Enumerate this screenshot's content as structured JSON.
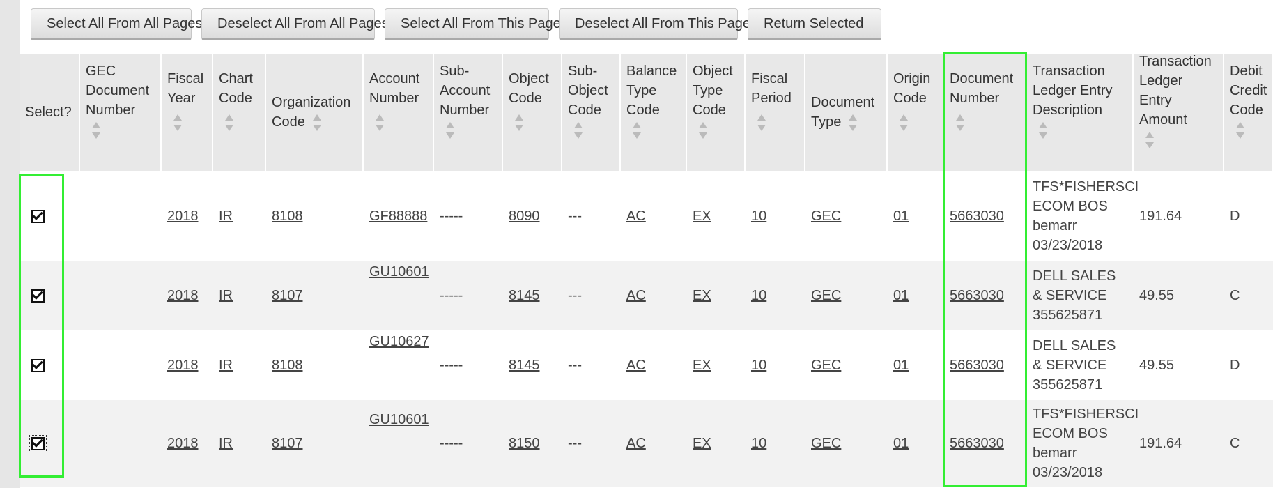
{
  "buttons": {
    "select_all_pages": "Select All From All Pages",
    "deselect_all_pages": "Deselect All From All Pages",
    "select_all_this_page": "Select All From This Page",
    "deselect_all_this_page": "Deselect All From This Page",
    "return_selected": "Return Selected"
  },
  "table": {
    "headers": {
      "select": "Select?",
      "gec_document_number": "GEC Document Number",
      "fiscal_year": "Fiscal Year",
      "chart_code": "Chart Code",
      "organization_code": "Organization Code",
      "account_number": "Account Number",
      "sub_account_number": "Sub-Account Number",
      "object_code": "Object Code",
      "sub_object_code": "Sub-Object Code",
      "balance_type_code": "Balance Type Code",
      "object_type_code": "Object Type Code",
      "fiscal_period": "Fiscal Period",
      "document_type": "Document Type",
      "origin_code": "Origin Code",
      "document_number": "Document Number",
      "description": "Transaction Ledger Entry Description",
      "amount": "Transaction Ledger Entry Amount",
      "debit_credit_code": "Debit Credit Code"
    },
    "rows": [
      {
        "selected": true,
        "gec_document_number": "",
        "fiscal_year": "2018",
        "chart_code": "IR",
        "organization_code": "8108",
        "account_number": "GF88888",
        "sub_account_number": "-----",
        "object_code": "8090",
        "sub_object_code": "---",
        "balance_type_code": "AC",
        "object_type_code": "EX",
        "fiscal_period": "10",
        "document_type": "GEC",
        "origin_code": "01",
        "document_number": "5663030",
        "description": "TFS*FISHERSCI ECOM BOS bemarr 03/23/2018",
        "amount": "191.64",
        "debit_credit_code": "D"
      },
      {
        "selected": true,
        "gec_document_number": "",
        "fiscal_year": "2018",
        "chart_code": "IR",
        "organization_code": "8107",
        "account_number": "GU10601",
        "sub_account_number": "-----",
        "object_code": "8145",
        "sub_object_code": "---",
        "balance_type_code": "AC",
        "object_type_code": "EX",
        "fiscal_period": "10",
        "document_type": "GEC",
        "origin_code": "01",
        "document_number": "5663030",
        "description": "DELL SALES & SERVICE 355625871",
        "amount": "49.55",
        "debit_credit_code": "C"
      },
      {
        "selected": true,
        "gec_document_number": "",
        "fiscal_year": "2018",
        "chart_code": "IR",
        "organization_code": "8108",
        "account_number": "GU10627",
        "sub_account_number": "-----",
        "object_code": "8145",
        "sub_object_code": "---",
        "balance_type_code": "AC",
        "object_type_code": "EX",
        "fiscal_period": "10",
        "document_type": "GEC",
        "origin_code": "01",
        "document_number": "5663030",
        "description": "DELL SALES & SERVICE 355625871",
        "amount": "49.55",
        "debit_credit_code": "D"
      },
      {
        "selected": true,
        "gec_document_number": "",
        "fiscal_year": "2018",
        "chart_code": "IR",
        "organization_code": "8107",
        "account_number": "GU10601",
        "sub_account_number": "-----",
        "object_code": "8150",
        "sub_object_code": "---",
        "balance_type_code": "AC",
        "object_type_code": "EX",
        "fiscal_period": "10",
        "document_type": "GEC",
        "origin_code": "01",
        "document_number": "5663030",
        "description": "TFS*FISHERSCI ECOM BOS bemarr 03/23/2018",
        "amount": "191.64",
        "debit_credit_code": "C"
      }
    ]
  },
  "colors": {
    "highlight": "#33ee33",
    "header_bg": "#e8e8e8",
    "row_alt_bg": "#f2f2f2"
  },
  "icons": {
    "sort": "sort-arrows-icon",
    "checkbox": "checked-checkbox"
  }
}
